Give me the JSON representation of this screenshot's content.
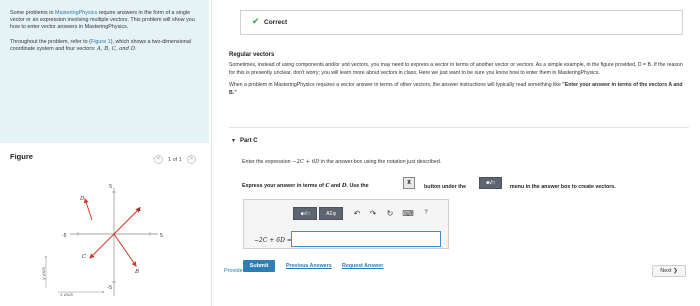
{
  "intro": {
    "para1_pre": "Some problems in ",
    "para1_link": "MasteringPhysics",
    "para1_post": " require answers in the form of a single vector or an expression involving multiple vectors. This problem will show you how to enter vector answers in MasteringPhysics.",
    "para2_pre": "Throughout the problem, refer to (",
    "para2_link": "Figure 1",
    "para2_post": "), which shows a two-dimensional coordinate system and four vectors: ",
    "para2_vectors": "A, B, C, and D."
  },
  "figure": {
    "title": "Figure",
    "pager_prev": "<",
    "pager_text": "1 of 1",
    "pager_next": ">",
    "graph": {
      "x_axis_label": "x axis",
      "y_axis_label": "y axis",
      "tick_labels": [
        "5",
        "-5",
        "5",
        "-5"
      ],
      "vector_labels": [
        "D",
        "A",
        "C",
        "B"
      ],
      "axis_color": "#888888",
      "vector_color": "#d03a2a"
    }
  },
  "feedback_banner": {
    "icon": "check-icon",
    "icon_glyph": "✔",
    "label": "Correct",
    "color": "#2e9e3a"
  },
  "info": {
    "heading": "Regular vectors",
    "para1": "Sometimes, instead of using components and/or unit vectors, you may need to express a vector in terms of another vector or vectors. As a simple example, in the figure provided, D = B. If the reason for this is presently unclear, don't worry; you will learn more about vectors in class. Here we just want to be sure you know how to enter them in MasteringPhysics.",
    "para2_pre": "When a problem in MasteringPhysics requires a vector answer in terms of other vectors, the answer instructions will typically read something like ",
    "para2_bold": "\"Enter your answer in terms of the vectors A and B.\""
  },
  "part": {
    "toggle_glyph": "▼",
    "label": "Part C"
  },
  "question": {
    "prompt_pre": "Enter the expression ",
    "prompt_expr": "−2C + 6D",
    "prompt_post": " in the answer box using the notation just described.",
    "instr_1": "Express your answer in terms of ",
    "instr_vec1": "C",
    "instr_2": " and ",
    "instr_vec2": "D",
    "instr_3": ". Use the",
    "instr_btn_vec": "x⃗",
    "instr_4": "button under the",
    "instr_btn_tmpl": "■√□",
    "instr_5": "menu in the answer box to create vectors."
  },
  "answer": {
    "toolbar": {
      "templates_label": "■√□",
      "greek_label": "ΑΣφ",
      "undo_glyph": "↶",
      "redo_glyph": "↷",
      "reset_glyph": "↻",
      "keyboard_glyph": "⌨",
      "help_glyph": "?"
    },
    "eq_label": "−2C + 6D =",
    "value": "",
    "accent": "#3a8fd1"
  },
  "actions": {
    "submit": "Submit",
    "previous_answers": "Previous Answers",
    "request_answer": "Request Answer",
    "provide_feedback": "Provide Feedback",
    "next": "Next ❯",
    "submit_color": "#2f7fb5"
  }
}
